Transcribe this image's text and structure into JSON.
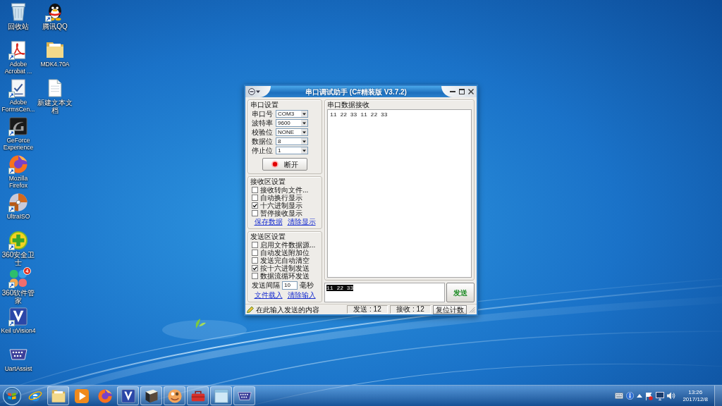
{
  "desktop": {
    "columns": [
      {
        "icons": [
          {
            "label": "回收站",
            "kind": "bin",
            "shortcut": false
          },
          {
            "label": "Adobe Acrobat ...",
            "kind": "pdf",
            "shortcut": true
          },
          {
            "label": "Adobe FormsCen...",
            "kind": "form",
            "shortcut": true
          },
          {
            "label": "GeForce Experience",
            "kind": "geforce",
            "shortcut": true
          },
          {
            "label": "Mozilla Firefox",
            "kind": "firefox",
            "shortcut": true
          },
          {
            "label": "UltraISO",
            "kind": "disc",
            "shortcut": true
          },
          {
            "label": "360安全卫士",
            "kind": "guard",
            "shortcut": true
          },
          {
            "label": "360软件管家",
            "kind": "petals",
            "shortcut": true,
            "badge": "4"
          },
          {
            "label": "Keil uVision4",
            "kind": "keil",
            "shortcut": true
          },
          {
            "label": "UartAssist",
            "kind": "serial",
            "shortcut": false
          }
        ]
      },
      {
        "icons": [
          {
            "label": "腾讯QQ",
            "kind": "penguin",
            "shortcut": true
          },
          {
            "label": "MDK4.70A",
            "kind": "folder",
            "shortcut": false
          },
          {
            "label": "新建文本文档",
            "kind": "textfile",
            "shortcut": false
          }
        ]
      }
    ]
  },
  "serial_window": {
    "title": "串口调试助手 (C#精装版 V3.7.2)",
    "port_settings": {
      "title": "串口设置",
      "fields": [
        {
          "label": "串口号",
          "value": "COM3"
        },
        {
          "label": "波特率",
          "value": "9600"
        },
        {
          "label": "校验位",
          "value": "NONE"
        },
        {
          "label": "数据位",
          "value": "8"
        },
        {
          "label": "停止位",
          "value": "1"
        }
      ],
      "button": {
        "label": "断开",
        "lamp_on": true
      }
    },
    "receive_settings": {
      "title": "接收区设置",
      "options": [
        {
          "label": "接收转向文件...",
          "checked": false
        },
        {
          "label": "自动换行显示",
          "checked": false
        },
        {
          "label": "十六进制显示",
          "checked": true
        },
        {
          "label": "暂停接收显示",
          "checked": false
        }
      ],
      "links": [
        "保存数据",
        "清除显示"
      ]
    },
    "send_settings": {
      "title": "发送区设置",
      "options": [
        {
          "label": "启用文件数据源...",
          "checked": false
        },
        {
          "label": "自动发送附加位",
          "checked": false
        },
        {
          "label": "发送完自动清空",
          "checked": false
        },
        {
          "label": "按十六进制发送",
          "checked": true
        },
        {
          "label": "数据流循环发送",
          "checked": false
        }
      ],
      "interval": {
        "label": "发送间隔",
        "value": "10",
        "unit": "毫秒"
      },
      "links": [
        "文件载入",
        "清除输入"
      ]
    },
    "receive_area": {
      "title": "串口数据接收",
      "content": "11 22 33 11 22 33"
    },
    "send_area": {
      "value": "11 22 33",
      "text_selected": true
    },
    "send_button": "发送",
    "status_bar": {
      "hint": "在此输入发送的内容",
      "sent": "发送 : 12",
      "received": "接收 : 12",
      "reset_button": "复位计数"
    }
  },
  "taskbar": {
    "items": [
      {
        "kind": "ie",
        "running": false
      },
      {
        "kind": "folder",
        "running": true
      },
      {
        "kind": "media",
        "running": false
      },
      {
        "kind": "firefox",
        "running": false
      },
      {
        "kind": "keil",
        "running": true
      },
      {
        "kind": "book",
        "running": true
      },
      {
        "kind": "paint",
        "running": true
      },
      {
        "kind": "toolbox",
        "running": true
      },
      {
        "kind": "window",
        "running": true
      },
      {
        "kind": "serial",
        "running": true
      }
    ],
    "clock": {
      "time": "13:26",
      "date": "2017/12/8"
    }
  }
}
